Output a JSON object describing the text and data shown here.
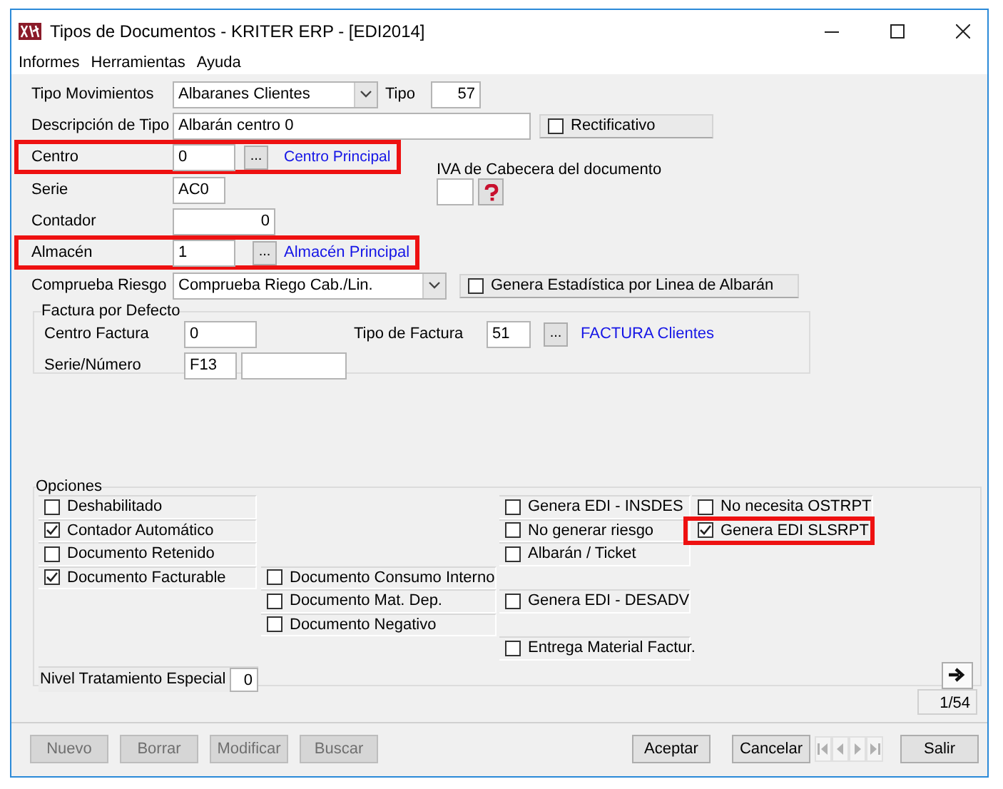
{
  "window": {
    "title": "Tipos de Documentos - KRITER ERP - [EDI2014]"
  },
  "menu": [
    {
      "label": "Informes"
    },
    {
      "label": "Herramientas"
    },
    {
      "label": "Ayuda"
    }
  ],
  "tipo_movimientos": {
    "label": "Tipo Movimientos",
    "value": "Albaranes Clientes",
    "tipo_label": "Tipo",
    "tipo_value": "57"
  },
  "descripcion": {
    "label": "Descripción de Tipo",
    "value": "Albarán centro 0",
    "rectificativo": {
      "label": "Rectificativo",
      "checked": false
    }
  },
  "centro": {
    "label": "Centro",
    "value": "0",
    "button": "...",
    "link": "Centro Principal",
    "highlighted": true
  },
  "iva": {
    "label": "IVA de Cabecera del documento"
  },
  "serie": {
    "label": "Serie",
    "value": "AC0"
  },
  "contador": {
    "label": "Contador",
    "value": "0"
  },
  "almacen": {
    "label": "Almacén",
    "value": "1",
    "button": "...",
    "link": "Almacén Principal",
    "highlighted": true
  },
  "comprueba_riesgo": {
    "label": "Comprueba Riesgo",
    "value": "Comprueba Riego Cab./Lin.",
    "estadistica": {
      "label": "Genera Estadística por Linea de Albarán",
      "checked": false
    }
  },
  "factura_por_defecto": {
    "title": "Factura por Defecto",
    "centro_label": "Centro Factura",
    "centro_value": "0",
    "tipo_label": "Tipo de Factura",
    "tipo_value": "51",
    "button": "...",
    "tipo_link": "FACTURA Clientes",
    "serie_label": "Serie/Número",
    "serie_value": "F13"
  },
  "opciones": {
    "title": "Opciones",
    "columns": [
      [
        {
          "label": "Deshabilitado",
          "checked": false,
          "highlighted": false
        },
        {
          "label": "Contador Automático",
          "checked": true,
          "highlighted": false
        },
        {
          "label": "Documento Retenido",
          "checked": false,
          "highlighted": false
        },
        {
          "label": "Documento Facturable",
          "checked": true,
          "highlighted": false
        }
      ],
      [
        {
          "label": "Documento Consumo Interno",
          "checked": false,
          "highlighted": false
        },
        {
          "label": "Documento Mat. Dep.",
          "checked": false,
          "highlighted": false
        },
        {
          "label": "Documento Negativo",
          "checked": false,
          "highlighted": false
        }
      ],
      [
        {
          "label": "Genera EDI - INSDES",
          "checked": false,
          "highlighted": false
        },
        {
          "label": "No generar riesgo",
          "checked": false,
          "highlighted": false
        },
        {
          "label": "Albarán / Ticket",
          "checked": false,
          "highlighted": false
        },
        {
          "label": "Genera EDI - DESADV",
          "checked": false,
          "highlighted": false
        },
        {
          "label": "Entrega Material Factur.",
          "checked": false,
          "highlighted": false
        }
      ],
      [
        {
          "label": "No necesita OSTRPT",
          "checked": false,
          "highlighted": false
        },
        {
          "label": "Genera EDI SLSRPT",
          "checked": true,
          "highlighted": true
        }
      ]
    ]
  },
  "nivel": {
    "label": "Nivel Tratamiento Especial",
    "value": "0"
  },
  "record_counter": "1/54",
  "buttons": [
    {
      "label": "Nuevo",
      "disabled": true
    },
    {
      "label": "Borrar",
      "disabled": true
    },
    {
      "label": "Modificar",
      "disabled": true
    },
    {
      "label": "Buscar",
      "disabled": true
    }
  ],
  "dialog_buttons": [
    {
      "label": "Aceptar",
      "disabled": false
    },
    {
      "label": "Cancelar",
      "disabled": false
    }
  ],
  "nav_buttons": [
    {
      "kind": "first",
      "disabled": true
    },
    {
      "kind": "prev",
      "disabled": true
    },
    {
      "kind": "next",
      "disabled": true
    },
    {
      "kind": "last",
      "disabled": true
    }
  ],
  "exit_button": {
    "label": "Salir",
    "disabled": false
  }
}
